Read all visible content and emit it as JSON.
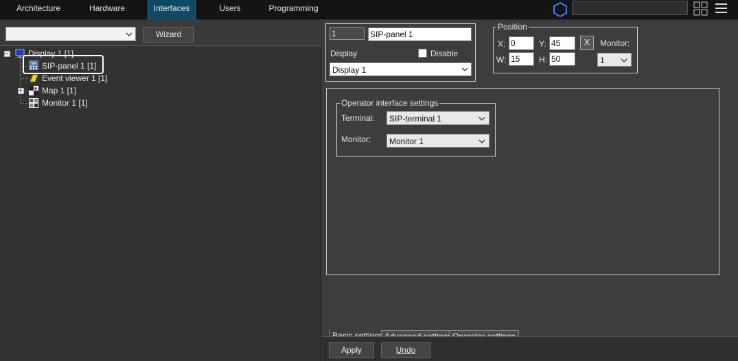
{
  "nav": {
    "tabs": [
      {
        "label": "Architecture"
      },
      {
        "label": "Hardware"
      },
      {
        "label": "Interfaces",
        "active": true
      },
      {
        "label": "Users"
      },
      {
        "label": "Programming"
      }
    ],
    "search_value": ""
  },
  "left": {
    "filter_value": "",
    "wizard_label": "Wizard",
    "tree": [
      {
        "label": "Display 1 [1]",
        "icon": "display-icon"
      },
      {
        "label": "SIP-panel 1 [1]",
        "icon": "sip-panel-icon",
        "selected": true
      },
      {
        "label": "Event viewer 1 [1]",
        "icon": "event-viewer-icon"
      },
      {
        "label": "Map 1 [1]",
        "icon": "map-icon"
      },
      {
        "label": "Monitor 1 [1]",
        "icon": "monitor-icon"
      }
    ]
  },
  "props": {
    "id_value": "1",
    "name_value": "SIP-panel 1",
    "display_label": "Display",
    "disable_label": "Disable",
    "display_value": "Display 1",
    "position": {
      "legend": "Position",
      "x_label": "X:",
      "x_value": "0",
      "y_label": "Y:",
      "y_value": "45",
      "w_label": "W:",
      "w_value": "15",
      "h_label": "H:",
      "h_value": "50",
      "x_button": "X",
      "monitor_label": "Monitor:",
      "monitor_value": "1"
    },
    "operator": {
      "legend": "Operator interface settings",
      "terminal_label": "Terminal:",
      "terminal_value": "SIP-terminal 1",
      "monitor_label": "Monitor:",
      "monitor_value": "Monitor 1"
    },
    "subtabs": [
      {
        "label": "Basic settings",
        "active": true
      },
      {
        "label": "Advanced settings"
      },
      {
        "label": "Operator settings"
      }
    ],
    "apply_label": "Apply",
    "undo_label": "Undo"
  }
}
